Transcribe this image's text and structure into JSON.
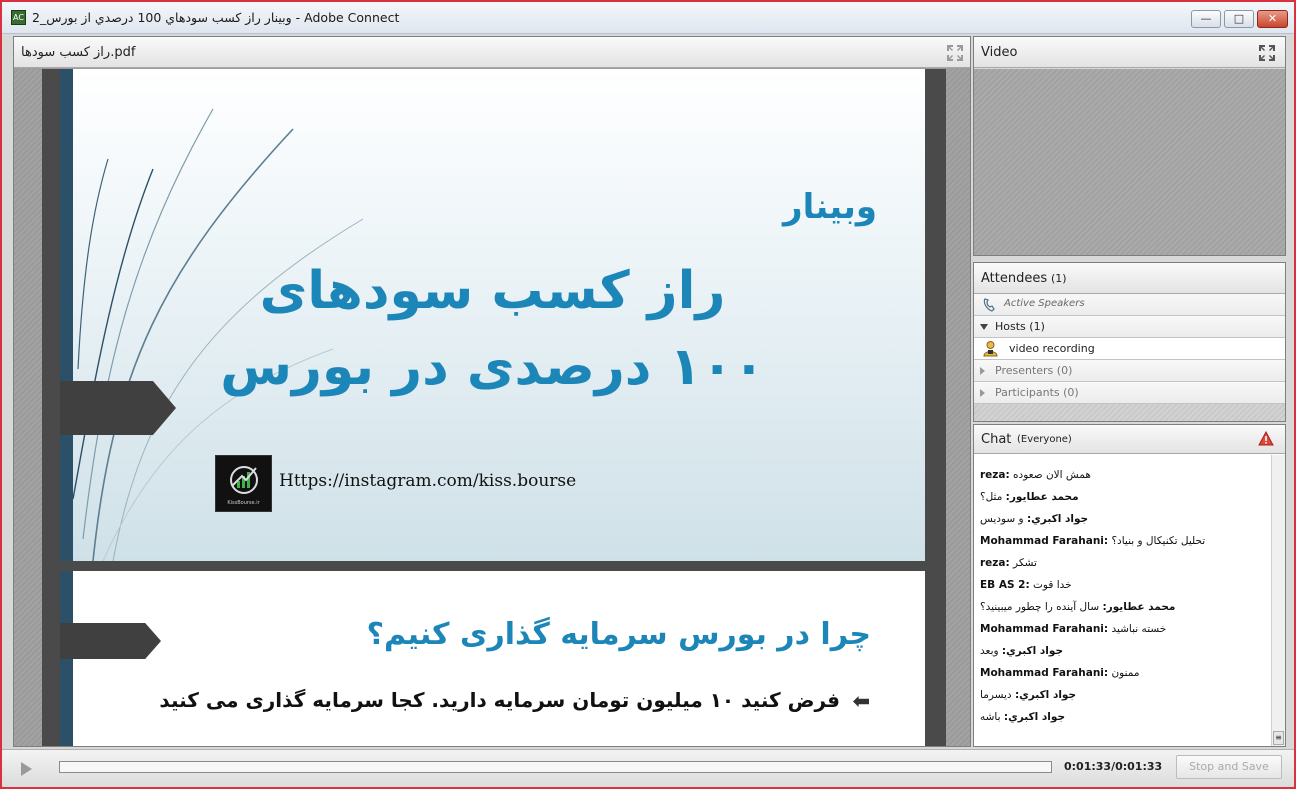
{
  "window": {
    "title": "وبينار راز كسب سودهاي 100 درصدي از بورس_2 - Adobe Connect",
    "buttons": [
      "minimize",
      "maximize",
      "close"
    ]
  },
  "share_pod": {
    "title": "راز كسب سودها.pdf"
  },
  "slide1": {
    "label": "وبینار",
    "title_line1": "راز کسب سودهای",
    "title_line2": "۱۰۰ درصدی در بورس",
    "logo_text": "KissBourse.ir",
    "url": "Https://instagram.com/kiss.bourse"
  },
  "slide2": {
    "heading": "چرا در بورس سرمایه گذاری کنیم؟",
    "bullet": "فرض کنید ۱۰ میلیون تومان سرمایه دارید. کجا سرمایه گذاری می کنید"
  },
  "video_pod": {
    "title": "Video"
  },
  "attendees_pod": {
    "title": "Attendees",
    "count": "(1)",
    "active_speakers": "Active Speakers",
    "hosts": "Hosts (1)",
    "host_user": "video recording",
    "presenters": "Presenters (0)",
    "participants": "Participants (0)"
  },
  "chat_pod": {
    "title": "Chat",
    "scope": "(Everyone)",
    "messages": [
      {
        "sender": "reza:",
        "text": "همش الان صعوده"
      },
      {
        "sender": "محمد عطايور:",
        "text": "مثل؟"
      },
      {
        "sender": "جواد اكبري:",
        "text": "و سودیس"
      },
      {
        "sender": "Mohammad Farahani:",
        "text": "تحلیل تکنیکال و بنیاد؟"
      },
      {
        "sender": "reza:",
        "text": "تشکر"
      },
      {
        "sender": "EB AS 2:",
        "text": "خدا قوت"
      },
      {
        "sender": "محمد عطايور:",
        "text": "سال آینده را چطور میبینید؟"
      },
      {
        "sender": "Mohammad Farahani:",
        "text": "خسته نباشید"
      },
      {
        "sender": "جواد اكبري:",
        "text": "وبعد"
      },
      {
        "sender": "Mohammad Farahani:",
        "text": "ممنون"
      },
      {
        "sender": "جواد اكبري:",
        "text": "دیسرما"
      },
      {
        "sender": "جواد اكبري:",
        "text": "باشه"
      }
    ]
  },
  "playback": {
    "timecode": "0:01:33/0:01:33",
    "stop_save_label": "Stop and Save",
    "progress": 0
  },
  "colors": {
    "slide_accent": "#1d86b8",
    "window_border": "#d9323e"
  }
}
